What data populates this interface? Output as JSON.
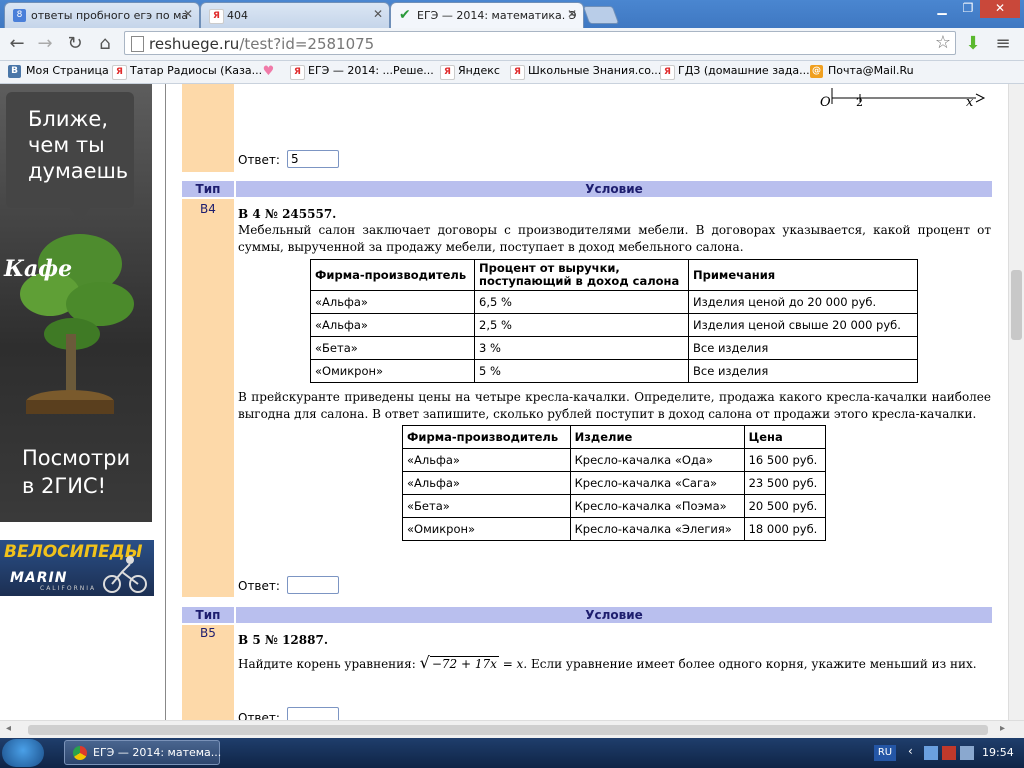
{
  "browser": {
    "tabs": [
      {
        "title": "ответы пробного егэ по ма",
        "favicon_color": "#4a7fd9",
        "favicon_glyph": "8"
      },
      {
        "title": "404",
        "favicon_color": "#e02b2b",
        "favicon_glyph": "Я"
      },
      {
        "title": "ЕГЭ — 2014: математика. Э",
        "favicon_color": "#2a9a3a",
        "favicon_glyph": "✔"
      }
    ],
    "url_host": "reshuege.ru",
    "url_path": "/test?id=2581075",
    "bookmarks": [
      {
        "label": "Моя Страница",
        "icon": "В",
        "color": "#4a76a8"
      },
      {
        "label": "Татар Радиосы (Каза...",
        "icon": "Я",
        "color": "#e02b2b"
      },
      {
        "label": "",
        "icon": "♥",
        "color": "#f07aa8"
      },
      {
        "label": "ЕГЭ — 2014: ...Реше...",
        "icon": "Я",
        "color": "#e02b2b"
      },
      {
        "label": "Яндекс",
        "icon": "Я",
        "color": "#e02b2b"
      },
      {
        "label": "Школьные Знания.co...",
        "icon": "Я",
        "color": "#e02b2b"
      },
      {
        "label": "ГДЗ (домашние зада...",
        "icon": "Я",
        "color": "#e02b2b"
      },
      {
        "label": "Почта@Mail.Ru",
        "icon": "@",
        "color": "#f0a020"
      }
    ]
  },
  "ads": {
    "bubble_lines": [
      "Ближе,",
      "чем ты",
      "думаешь"
    ],
    "cafe": "Кафе",
    "cta_lines": [
      "Посмотри",
      "в 2ГИС!"
    ],
    "bike_title": "ВЕЛОСИПЕДЫ",
    "bike_brand": "MARIN",
    "bike_sub": "CALIFORNIA"
  },
  "top_fragment": {
    "axis_origin": "O",
    "axis_tick": "2",
    "axis_var": "x",
    "answer_label": "Ответ:",
    "answer_value": "5"
  },
  "headers": {
    "type": "Тип",
    "condition": "Условие"
  },
  "task_b4": {
    "code": "B4",
    "title": "B 4 № 245557.",
    "intro": "Мебельный салон заключает договоры с производителями мебели. В договорах указывается, какой процент от суммы, вырученной за продажу мебели, поступает в доход мебельного салона.",
    "table1": {
      "headers": [
        "Фирма-производитель",
        "Процент от выручки, поступающий в доход салона",
        "Примечания"
      ],
      "rows": [
        [
          "«Альфа»",
          "6,5 %",
          "Изделия ценой до 20 000 руб."
        ],
        [
          "«Альфа»",
          "2,5 %",
          "Изделия ценой свыше 20 000 руб."
        ],
        [
          "«Бета»",
          "3 %",
          "Все изделия"
        ],
        [
          "«Омикрон»",
          "5 %",
          "Все изделия"
        ]
      ]
    },
    "middle": "В прейскуранте приведены цены на четыре кресла-качалки. Определите, продажа какого кресла-качалки наиболее выгодна для салона. В ответ запишите, сколько рублей поступит в доход салона от продажи этого кресла-качалки.",
    "table2": {
      "headers": [
        "Фирма-производитель",
        "Изделие",
        "Цена"
      ],
      "rows": [
        [
          "«Альфа»",
          "Кресло-качалка «Ода»",
          "16 500 руб."
        ],
        [
          "«Альфа»",
          "Кресло-качалка «Сага»",
          "23 500 руб."
        ],
        [
          "«Бета»",
          "Кресло-качалка «Поэма»",
          "20 500 руб."
        ],
        [
          "«Омикрон»",
          "Кресло-качалка «Элегия»",
          "18 000 руб."
        ]
      ]
    },
    "answer_label": "Ответ:",
    "answer_value": ""
  },
  "task_b5": {
    "code": "B5",
    "title": "B 5 № 12887.",
    "prefix": "Найдите корень уравнения:",
    "formula_radicand": "−72 + 17x",
    "formula_rhs": "= x.",
    "suffix": "Если уравнение имеет более одного корня, укажите меньший из них.",
    "answer_label": "Ответ:"
  },
  "taskbar": {
    "window_title": "ЕГЭ — 2014: матема...",
    "lang": "RU",
    "clock": "19:54"
  }
}
